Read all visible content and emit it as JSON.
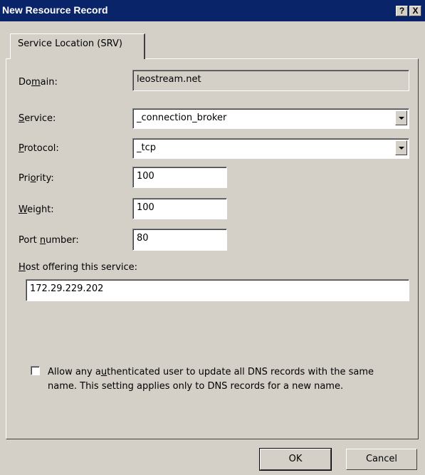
{
  "window": {
    "title": "New Resource Record",
    "help_button": "?",
    "close_button": "X"
  },
  "tab": {
    "label": "Service Location (SRV)"
  },
  "domain": {
    "label_pre": "Do",
    "label_key": "m",
    "label_post": "ain:",
    "value": "leostream.net"
  },
  "service": {
    "label_key": "S",
    "label_post": "ervice:",
    "value": "_connection_broker"
  },
  "protocol": {
    "label_key": "P",
    "label_post": "rotocol:",
    "value": "_tcp"
  },
  "priority": {
    "label_pre": "Pri",
    "label_key": "o",
    "label_post": "rity:",
    "value": "100"
  },
  "weight": {
    "label_key": "W",
    "label_post": "eight:",
    "value": "100"
  },
  "port": {
    "label_pre": "Port ",
    "label_key": "n",
    "label_post": "umber:",
    "value": "80"
  },
  "host": {
    "label_key": "H",
    "label_post": "ost offering this service:",
    "value": "172.29.229.202"
  },
  "allow_update": {
    "checked": false,
    "line1_pre": "Allow any a",
    "line1_key": "u",
    "line1_post": "thenticated user to update all DNS records with the same",
    "line2": "name. This setting applies only to DNS records for a new name."
  },
  "buttons": {
    "ok": "OK",
    "cancel": "Cancel"
  }
}
